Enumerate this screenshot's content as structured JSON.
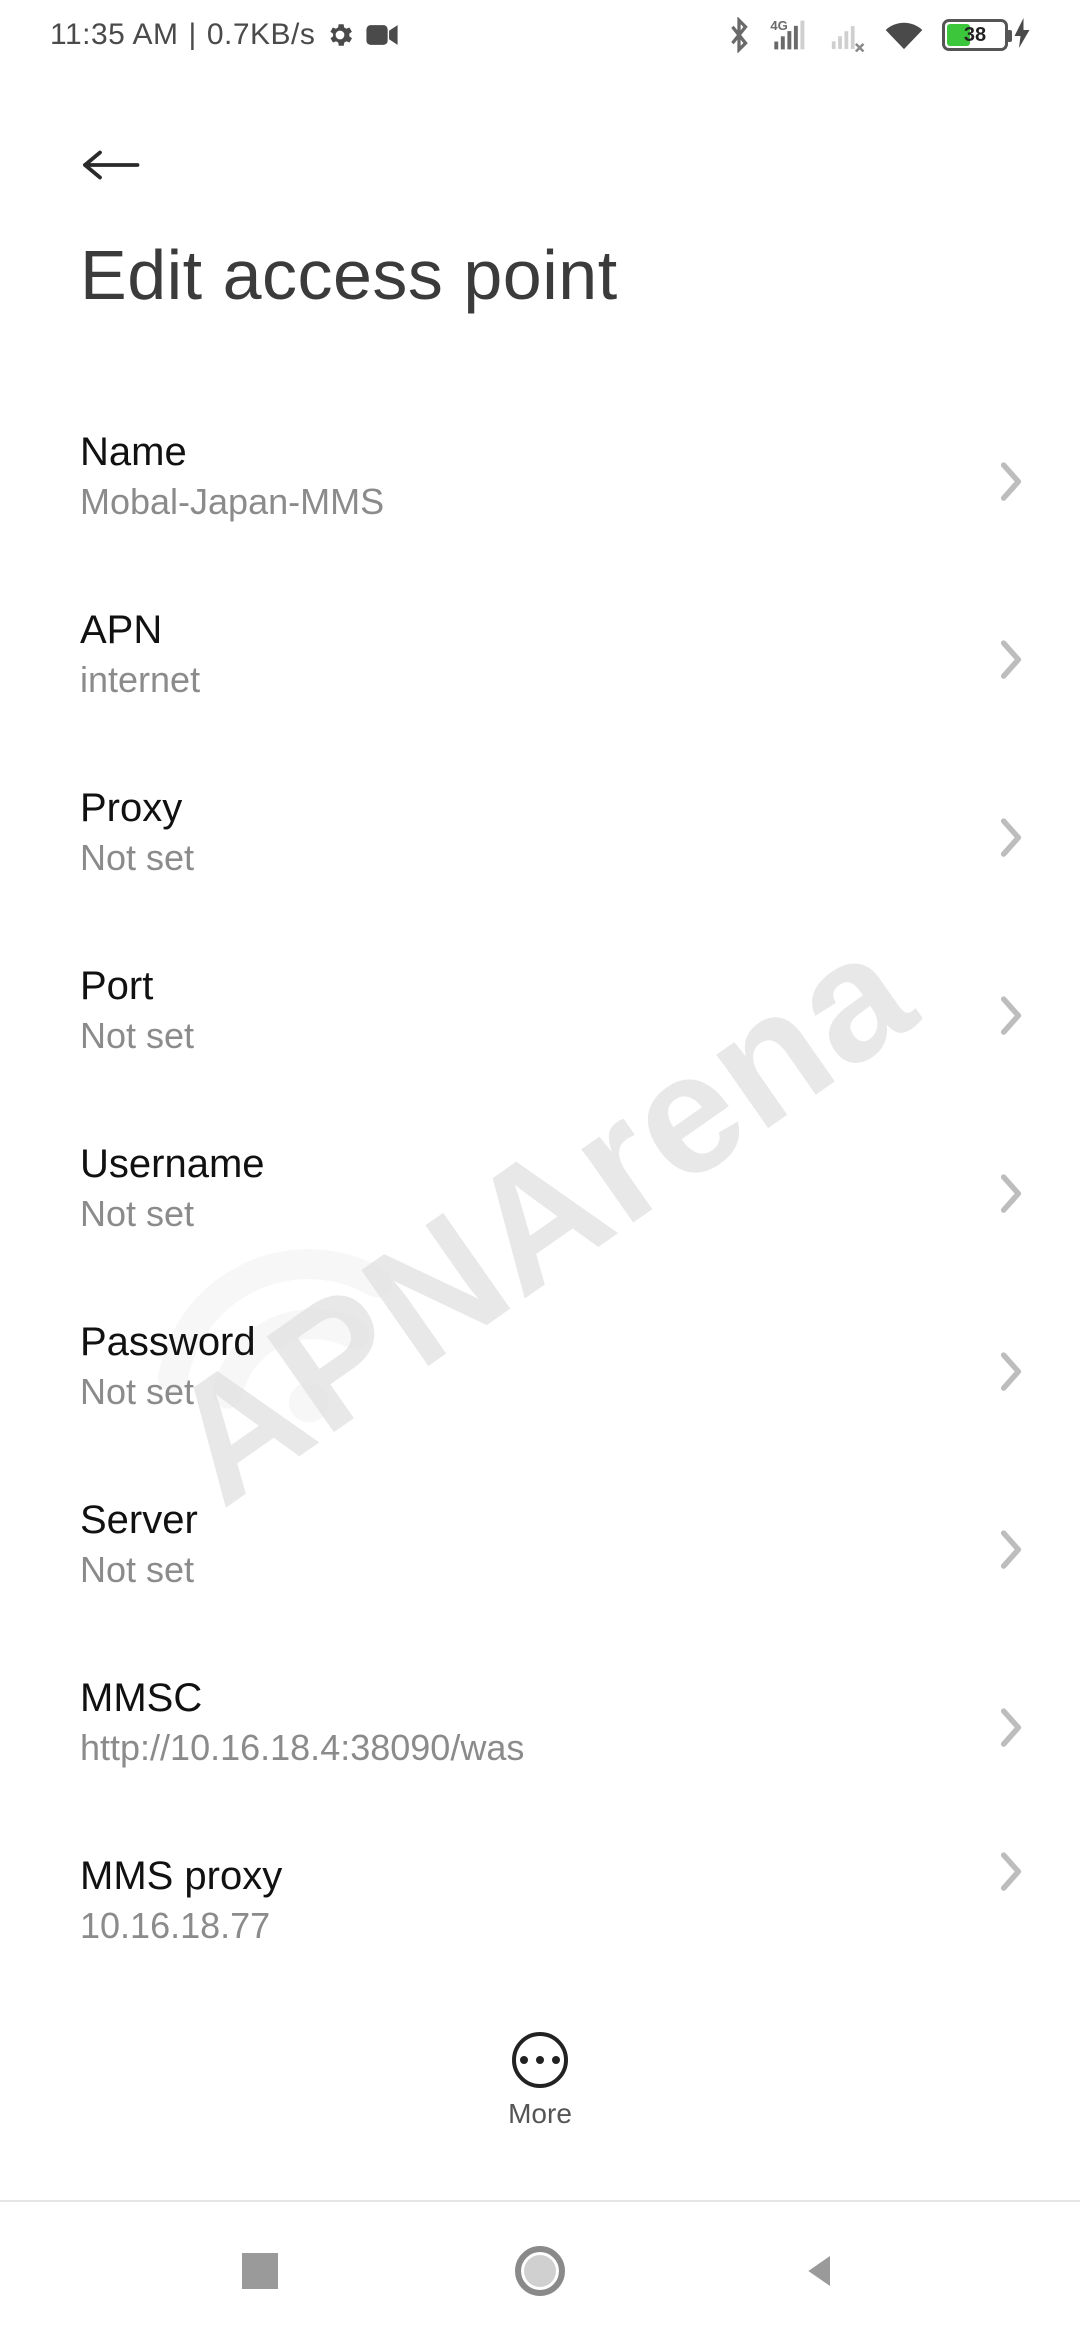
{
  "status": {
    "time": "11:35 AM",
    "separator": "|",
    "net_speed": "0.7KB/s",
    "battery_percent": "38"
  },
  "page": {
    "title": "Edit access point"
  },
  "fields": [
    {
      "label": "Name",
      "value": "Mobal-Japan-MMS"
    },
    {
      "label": "APN",
      "value": "internet"
    },
    {
      "label": "Proxy",
      "value": "Not set"
    },
    {
      "label": "Port",
      "value": "Not set"
    },
    {
      "label": "Username",
      "value": "Not set"
    },
    {
      "label": "Password",
      "value": "Not set"
    },
    {
      "label": "Server",
      "value": "Not set"
    },
    {
      "label": "MMSC",
      "value": "http://10.16.18.4:38090/was"
    },
    {
      "label": "MMS proxy",
      "value": "10.16.18.77"
    }
  ],
  "footer": {
    "more": "More"
  },
  "watermark": "APNArena"
}
